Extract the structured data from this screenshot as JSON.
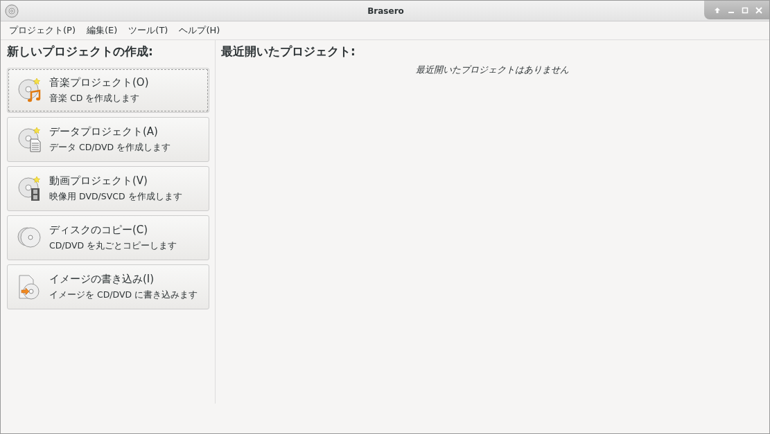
{
  "window": {
    "title": "Brasero"
  },
  "menu": [
    "プロジェクト(P)",
    "編集(E)",
    "ツール(T)",
    "ヘルプ(H)"
  ],
  "new_project": {
    "heading": "新しいプロジェクトの作成:",
    "items": [
      {
        "kind": "audio",
        "label": "音楽プロジェクト(O)",
        "description": "音楽 CD を作成します",
        "focused": true
      },
      {
        "kind": "data",
        "label": "データプロジェクト(A)",
        "description": "データ CD/DVD を作成します",
        "focused": false
      },
      {
        "kind": "video",
        "label": "動画プロジェクト(V)",
        "description": "映像用 DVD/SVCD を作成します",
        "focused": false
      },
      {
        "kind": "copy",
        "label": "ディスクのコピー(C)",
        "description": "CD/DVD を丸ごとコピーします",
        "focused": false
      },
      {
        "kind": "image",
        "label": "イメージの書き込み(I)",
        "description": "イメージを CD/DVD に書き込みます",
        "focused": false
      }
    ]
  },
  "recent": {
    "heading": "最近開いたプロジェクト:",
    "empty_message": "最近開いたプロジェクトはありません"
  }
}
